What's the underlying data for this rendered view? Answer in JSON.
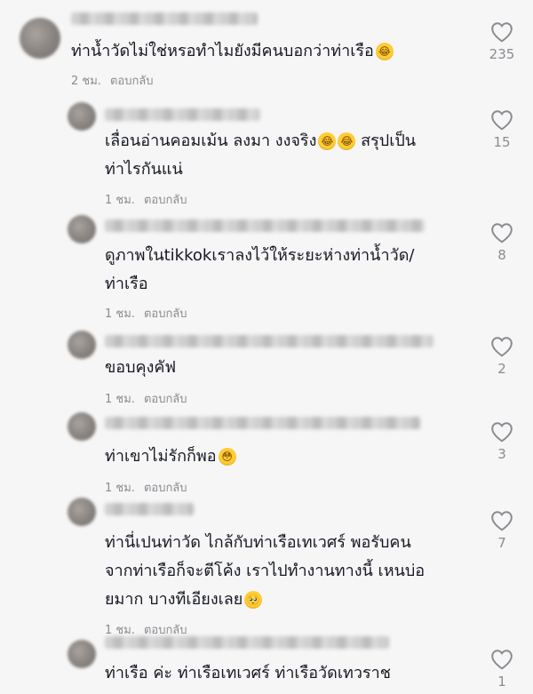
{
  "comments": [
    {
      "text_lines": [
        "ท่าน้ำวัดไม่ใช่หรอทำไมยังมีคนบอกว่าท่าเรือ"
      ],
      "emoji": "😂",
      "time": "2 ชม.",
      "reply": "ตอบกลับ",
      "likes": "235"
    },
    {
      "text_lines": [
        "เลื่อนอ่านคอมเม้น ลงมา งงจริง",
        "ท่าไรกันแน่"
      ],
      "emoji_inline": "😂😂",
      "suffix": " สรุปเป็น",
      "time": "1 ชม.",
      "reply": "ตอบกลับ",
      "likes": "15"
    },
    {
      "text_lines": [
        "ดูภาพในtikkokเราลงไว้ให้ระยะห่างท่าน้ำวัด/",
        "ท่าเรือ"
      ],
      "time": "1 ชม.",
      "reply": "ตอบกลับ",
      "likes": "8"
    },
    {
      "text_lines": [
        "ขอบคุงคัฟ"
      ],
      "time": "1 ชม.",
      "reply": "ตอบกลับ",
      "likes": "2"
    },
    {
      "text_lines": [
        "ท่าเขาไม่รักก็พอ"
      ],
      "emoji": "😳",
      "time": "1 ชม.",
      "reply": "ตอบกลับ",
      "likes": "3"
    },
    {
      "text_lines": [
        "ท่านี่เปนท่าวัด ไกล้กับท่าเรือเทเวศร์ พอรับคน",
        "จากท่าเรือก็จะตีโค้ง เราไปทำงานทางนี้ เหนบ่อ",
        "ยมาก บางทีเอียงเลย"
      ],
      "emoji": "🥺",
      "time": "1 ชม.",
      "reply": "ตอบกลับ",
      "likes": "7"
    },
    {
      "text_lines": [
        "ท่าเรือ ค่ะ ท่าเรือเทเวศร์ ท่าเรือวัดเทวราช"
      ],
      "likes": "1"
    }
  ]
}
